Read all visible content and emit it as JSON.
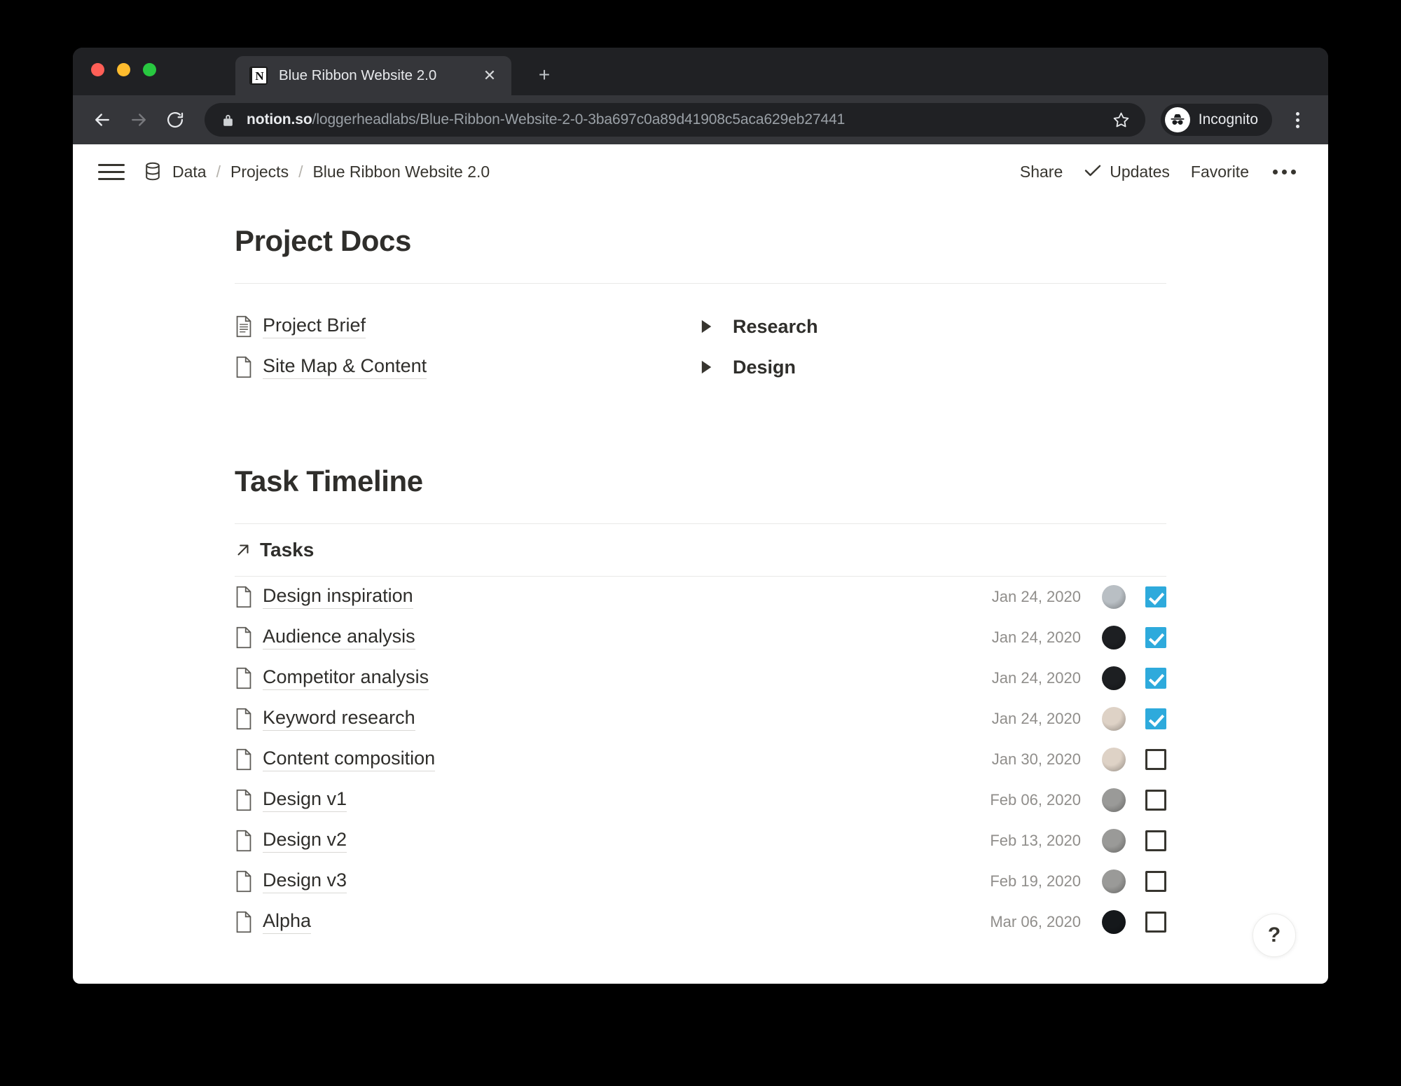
{
  "browser": {
    "tab": {
      "title": "Blue Ribbon Website 2.0",
      "favicon": "notion-icon",
      "close_label": "✕"
    },
    "new_tab_label": "+",
    "url": {
      "host": "notion.so",
      "path": "/loggerheadlabs/Blue-Ribbon-Website-2-0-3ba697c0a89d41908c5aca629eb27441"
    },
    "profile_label": "Incognito"
  },
  "notion": {
    "breadcrumb": {
      "items": [
        "Data",
        "Projects",
        "Blue Ribbon Website 2.0"
      ],
      "separator": "/"
    },
    "actions": {
      "share": "Share",
      "updates": "Updates",
      "favorite": "Favorite"
    },
    "sections": [
      {
        "heading": "Project Docs",
        "left_items": [
          {
            "label": "Project Brief",
            "icon": "document-lines-icon"
          },
          {
            "label": "Site Map & Content",
            "icon": "document-blank-icon"
          }
        ],
        "right_items": [
          {
            "label": "Research",
            "icon": "toggle-triangle-icon"
          },
          {
            "label": "Design",
            "icon": "toggle-triangle-icon"
          }
        ]
      },
      {
        "heading": "Task Timeline",
        "linked_db": {
          "label": "Tasks",
          "icon": "arrow-up-right-icon"
        },
        "tasks": [
          {
            "name": "Design inspiration",
            "date": "Jan 24, 2020",
            "done": true,
            "avatar": "#b9bfc4"
          },
          {
            "name": "Audience analysis",
            "date": "Jan 24, 2020",
            "done": true,
            "avatar": "#1d1f22"
          },
          {
            "name": "Competitor analysis",
            "date": "Jan 24, 2020",
            "done": true,
            "avatar": "#1d1f22"
          },
          {
            "name": "Keyword research",
            "date": "Jan 24, 2020",
            "done": true,
            "avatar": "#ded2c6"
          },
          {
            "name": "Content composition",
            "date": "Jan 30, 2020",
            "done": false,
            "avatar": "#ded2c6"
          },
          {
            "name": "Design v1",
            "date": "Feb 06, 2020",
            "done": false,
            "avatar": "#9a9a98"
          },
          {
            "name": "Design v2",
            "date": "Feb 13, 2020",
            "done": false,
            "avatar": "#9a9a98"
          },
          {
            "name": "Design v3",
            "date": "Feb 19, 2020",
            "done": false,
            "avatar": "#9a9a98"
          },
          {
            "name": "Alpha",
            "date": "Mar 06, 2020",
            "done": false,
            "avatar": "#15181b"
          }
        ]
      }
    ],
    "help_label": "?"
  },
  "colors": {
    "accent_checkbox": "#2eaadc",
    "browser_chrome": "#35363a",
    "tabstrip": "#202124",
    "text": "#37352f"
  }
}
